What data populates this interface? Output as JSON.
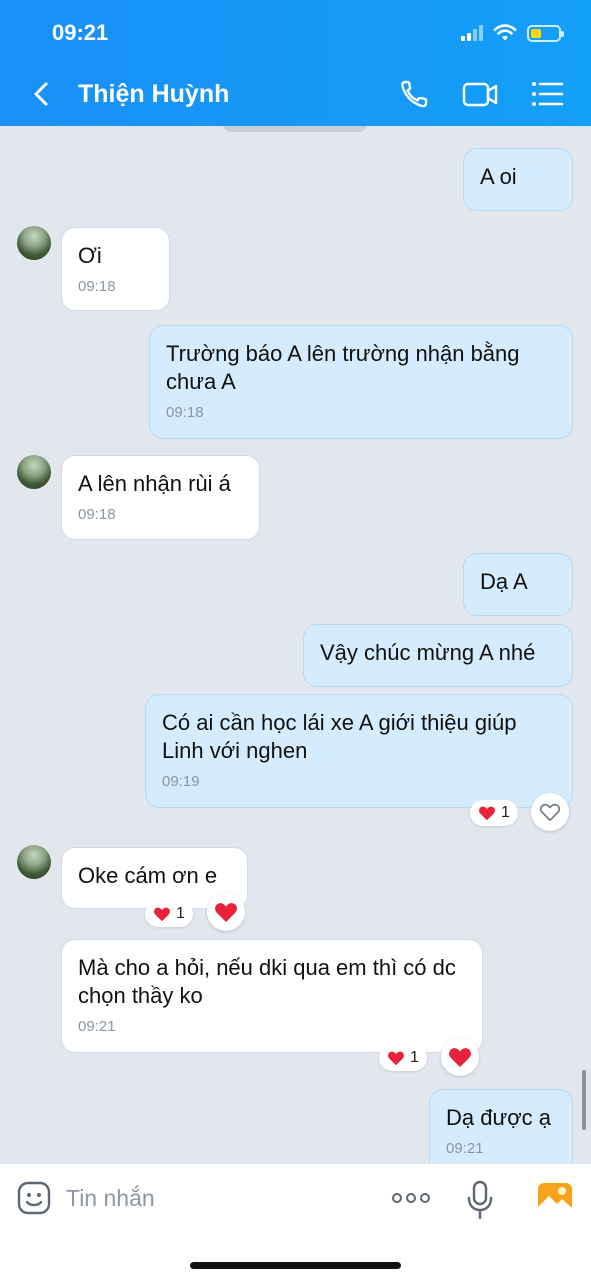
{
  "status_bar": {
    "time": "09:21"
  },
  "header": {
    "contact_name": "Thiện Huỳnh"
  },
  "messages": [
    {
      "side": "out",
      "text": "A oi",
      "time": ""
    },
    {
      "side": "in",
      "text": "Ơi",
      "time": "09:18"
    },
    {
      "side": "out",
      "text": "Trường báo A lên trường nhận bằng chưa A",
      "time": "09:18"
    },
    {
      "side": "in",
      "text": "A lên nhận rùi á",
      "time": "09:18"
    },
    {
      "side": "out",
      "text": "Dạ A",
      "time": ""
    },
    {
      "side": "out",
      "text": "Vậy chúc mừng A nhé",
      "time": ""
    },
    {
      "side": "out",
      "text": "Có ai cần học lái xe A giới thiệu giúp Linh với nghen",
      "time": "09:19",
      "reaction_count": "1"
    },
    {
      "side": "in",
      "text": "Oke cám ơn e",
      "time": "",
      "reaction_count": "1"
    },
    {
      "side": "in",
      "text": "Mà cho a hỏi, nếu dki qua em thì có dc chọn thầy ko",
      "time": "09:21",
      "reaction_count": "1"
    },
    {
      "side": "out",
      "text": "Dạ được ạ",
      "time": "09:21"
    }
  ],
  "input": {
    "placeholder": "Tin nhắn"
  },
  "colors": {
    "header": "#1a8ff5",
    "out_bubble": "#d4ecfd",
    "in_bubble": "#ffffff",
    "heart": "#e8223a"
  }
}
